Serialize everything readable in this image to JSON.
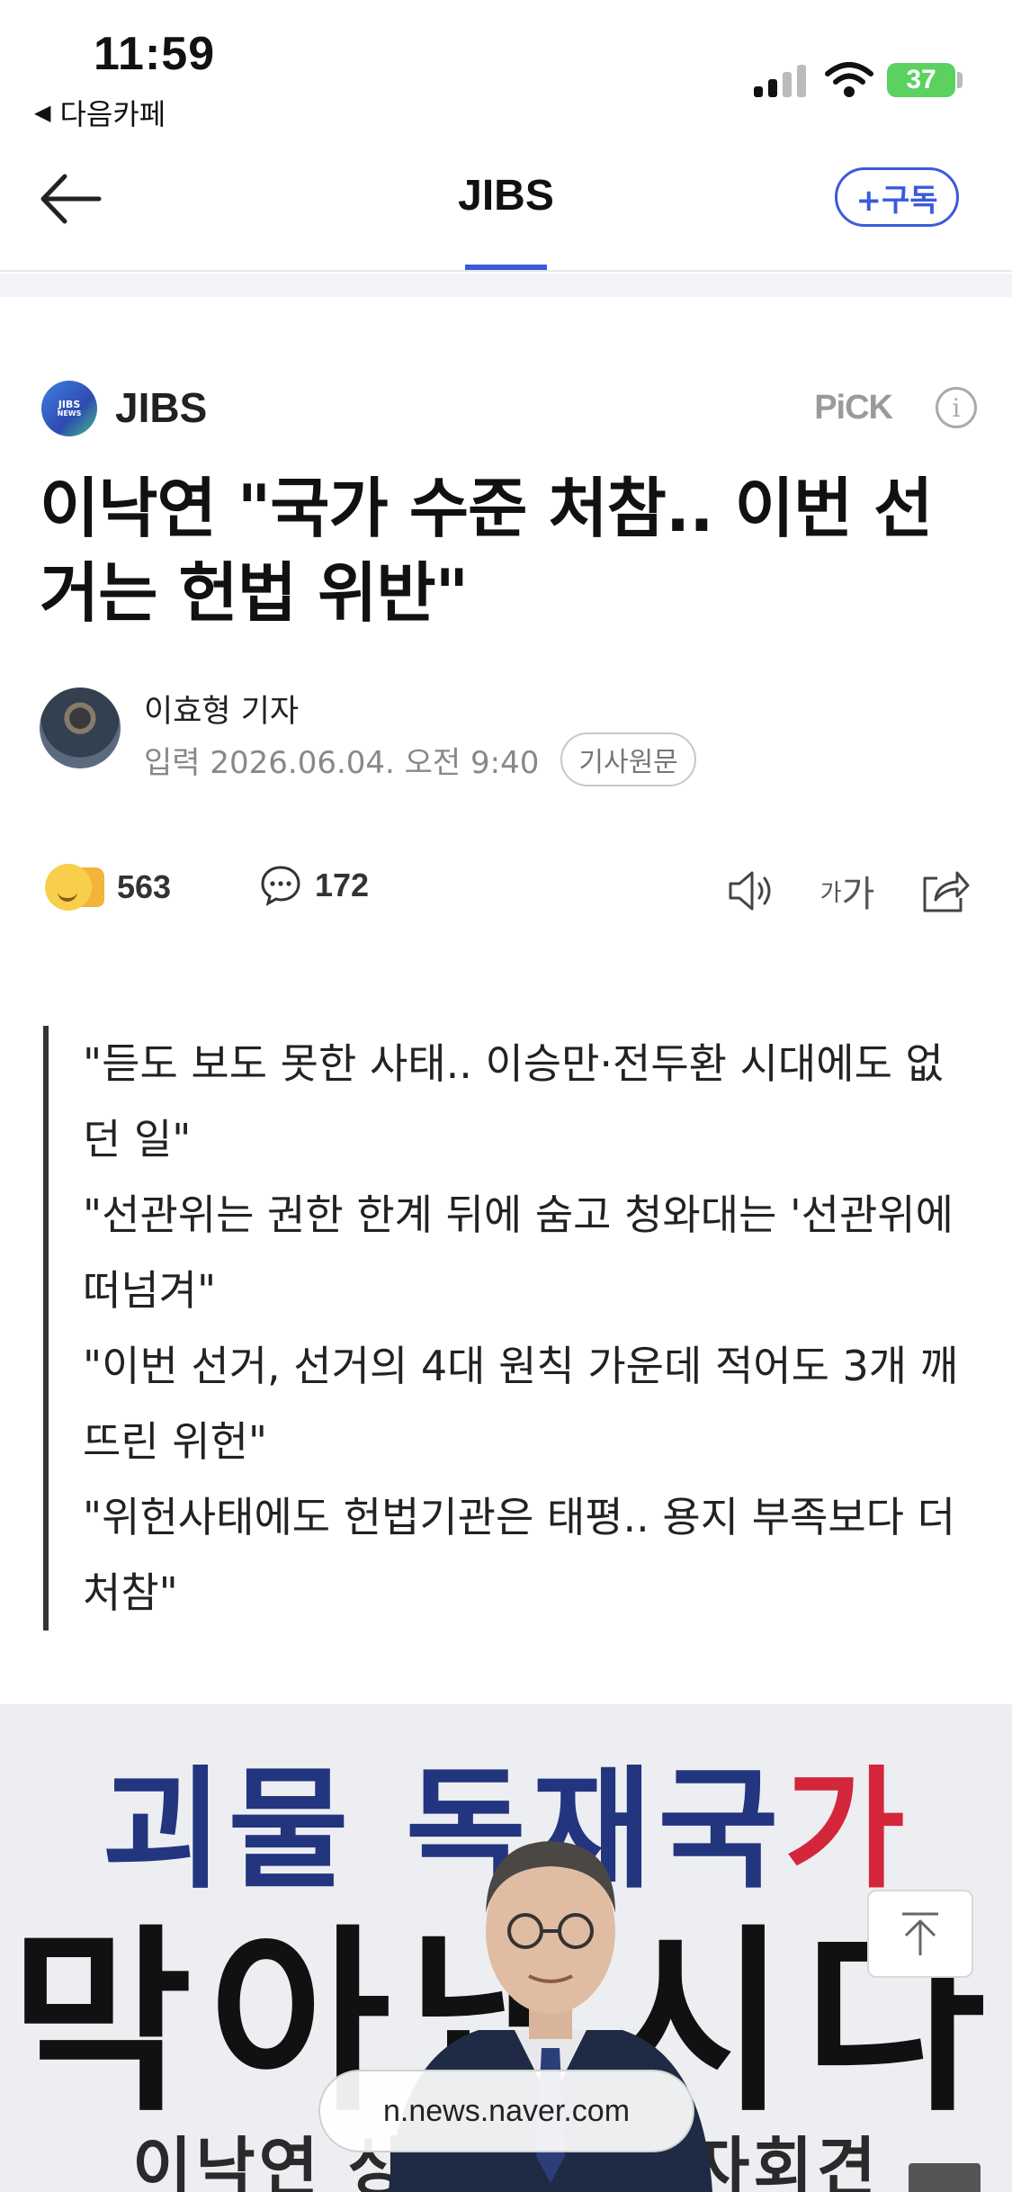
{
  "status_bar": {
    "time": "11:59",
    "back_app": "다음카페",
    "battery": "37"
  },
  "navbar": {
    "title": "JIBS",
    "subscribe": "+구독"
  },
  "article": {
    "press_name": "JIBS",
    "press_logo_text": "JIBS",
    "press_logo_sub": "NEWS",
    "pick_label": "PiCK",
    "headline": "이낙연 \"국가 수준 처참.. 이번 선거는 헌법 위반\"",
    "reporter": "이효형 기자",
    "byline": "입력 2026.06.04. 오전 9:40",
    "original_link": "기사원문",
    "reaction_count": "563",
    "comment_count": "172",
    "fontsize_label_small": "가",
    "fontsize_label_large": "가",
    "summary": [
      "\"듣도 보도 못한 사태.. 이승만·전두환 시대에도 없던 일\"",
      "\"선관위는 권한 한계 뒤에 숨고 청와대는 '선관위에 떠넘겨\"",
      "\"이번 선거, 선거의 4대 원칙 가운데 적어도 3개 깨뜨린 위헌\"",
      "\"위헌사태에도 헌법기관은 태평.. 용지 부족보다 더 처참\""
    ],
    "photo": {
      "banner_top_a": "괴물 독재국",
      "banner_top_b": "가",
      "banner_mid": "막아냅시다",
      "banner_bot": "이낙연 상임고문 기자회견"
    }
  },
  "url_pill": "n.news.naver.com",
  "colors": {
    "accent": "#3b5bdb",
    "banner_blue": "#23357f",
    "banner_red": "#d4263a"
  },
  "icons": [
    "back-arrow-icon",
    "signal-icon",
    "wifi-icon",
    "battery-icon",
    "info-icon",
    "reaction-emoji-icon",
    "comment-icon",
    "speaker-icon",
    "font-size-icon",
    "share-icon",
    "scroll-top-icon"
  ]
}
